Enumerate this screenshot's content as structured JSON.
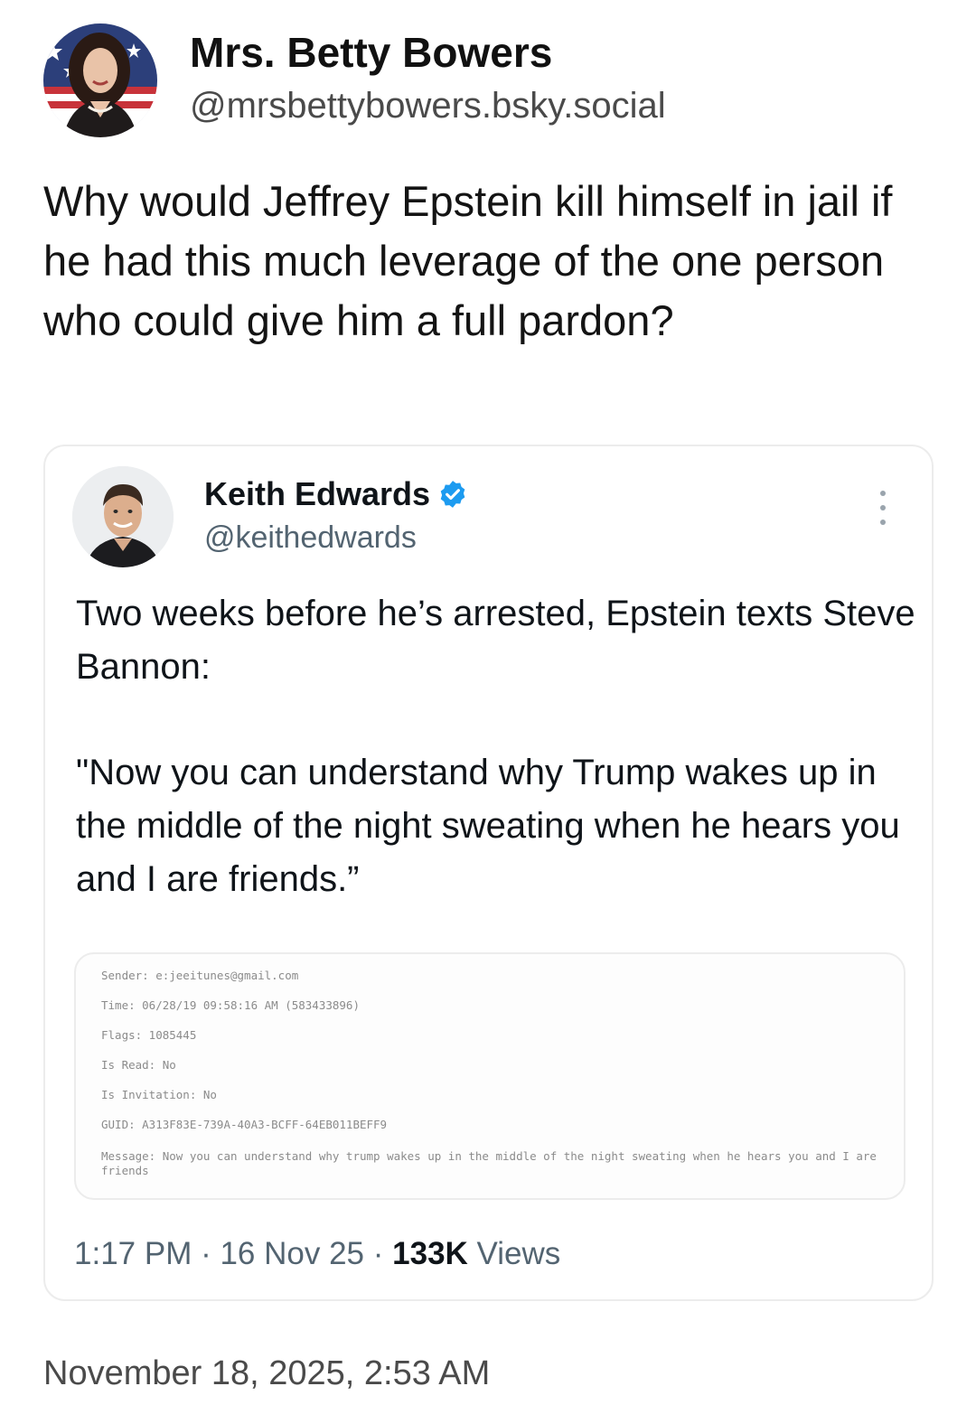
{
  "post": {
    "author_name": "Mrs. Betty Bowers",
    "author_handle": "@mrsbettybowers.bsky.social",
    "text": "Why would Jeffrey Epstein kill himself in jail if he had this much leverage of the one person who could give him a full pardon?",
    "date": "November 18, 2025, 2:53 AM"
  },
  "quoted": {
    "author_name": "Keith Edwards",
    "author_handle": "@keithedwards",
    "verified_icon": "verified-badge-icon",
    "more_icon": "more-vertical-icon",
    "paragraph_1": "Two weeks before he’s arrested, Epstein texts Steve Bannon:",
    "paragraph_2": "\"Now you can understand why Trump wakes up in the middle of the night sweating when he hears you and I are friends.”",
    "record": {
      "sender": "Sender: e:jeeitunes@gmail.com",
      "time": "Time: 06/28/19 09:58:16 AM (583433896)",
      "flags": "Flags: 1085445",
      "is_read": "Is Read: No",
      "is_invitation": "Is Invitation: No",
      "guid": "GUID: A313F83E-739A-40A3-BCFF-64EB011BEFF9",
      "message": "Message: Now you can understand why trump wakes up in the middle of the night sweating when he hears you and I are friends"
    },
    "time": "1:17 PM",
    "sep1": " · ",
    "date": "16 Nov 25",
    "sep2": " · ",
    "views_count": "133K",
    "views_label": " Views",
    "accent_color": "#1d9bf0"
  }
}
